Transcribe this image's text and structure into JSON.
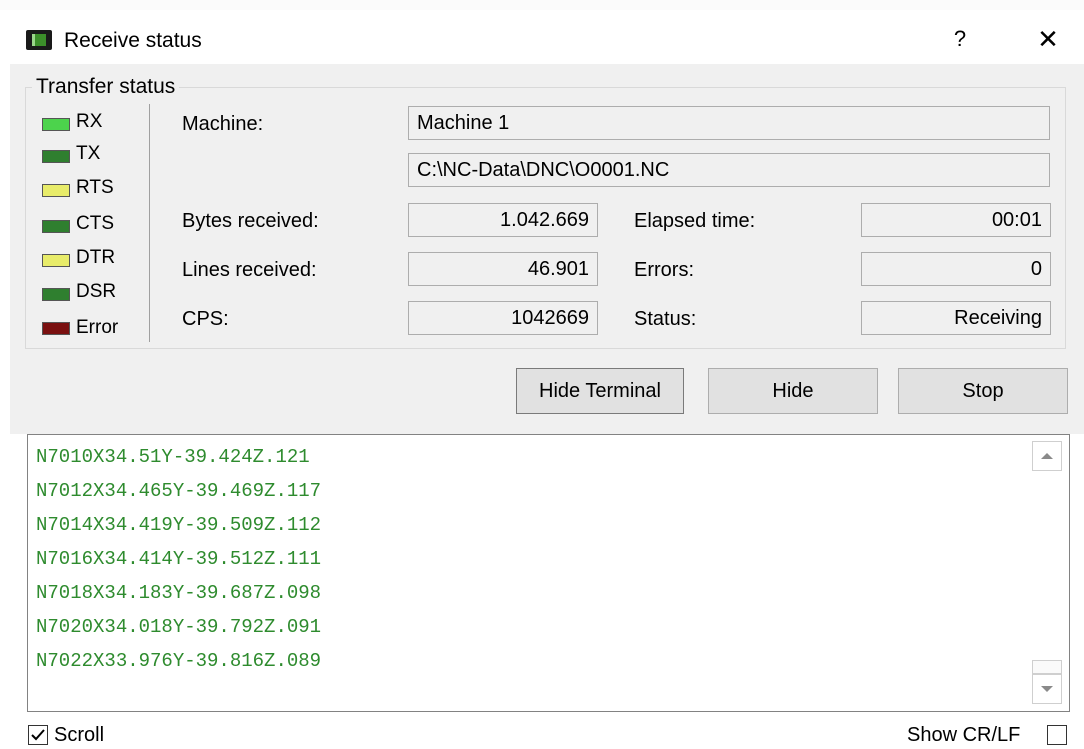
{
  "window": {
    "title": "Receive status",
    "help_label": "?",
    "close_label": "✕"
  },
  "group": {
    "label": "Transfer status"
  },
  "signals": [
    {
      "label": "RX",
      "color": "#4cd34c"
    },
    {
      "label": "TX",
      "color": "#2f7f2f"
    },
    {
      "label": "RTS",
      "color": "#e8ec6a"
    },
    {
      "label": "CTS",
      "color": "#2f7f2f"
    },
    {
      "label": "DTR",
      "color": "#e8ec6a"
    },
    {
      "label": "DSR",
      "color": "#2f7f2f"
    },
    {
      "label": "Error",
      "color": "#7a1010"
    }
  ],
  "fields": {
    "machine_label": "Machine:",
    "machine_value": "Machine 1",
    "path_value": "C:\\NC-Data\\DNC\\O0001.NC",
    "bytes_label": "Bytes received:",
    "bytes_value": "1.042.669",
    "lines_label": "Lines received:",
    "lines_value": "46.901",
    "cps_label": "CPS:",
    "cps_value": "1042669",
    "elapsed_label": "Elapsed time:",
    "elapsed_value": "00:01",
    "errors_label": "Errors:",
    "errors_value": "0",
    "status_label": "Status:",
    "status_value": "Receiving"
  },
  "buttons": {
    "hide_terminal": "Hide Terminal",
    "hide": "Hide",
    "stop": "Stop"
  },
  "terminal": {
    "color": "#2e8b2e",
    "lines": [
      "N7010X34.51Y-39.424Z.121",
      "N7012X34.465Y-39.469Z.117",
      "N7014X34.419Y-39.509Z.112",
      "N7016X34.414Y-39.512Z.111",
      "N7018X34.183Y-39.687Z.098",
      "N7020X34.018Y-39.792Z.091",
      "N7022X33.976Y-39.816Z.089"
    ]
  },
  "footer": {
    "scroll_label": "Scroll",
    "scroll_checked": true,
    "crlf_label": "Show CR/LF",
    "crlf_checked": false
  }
}
